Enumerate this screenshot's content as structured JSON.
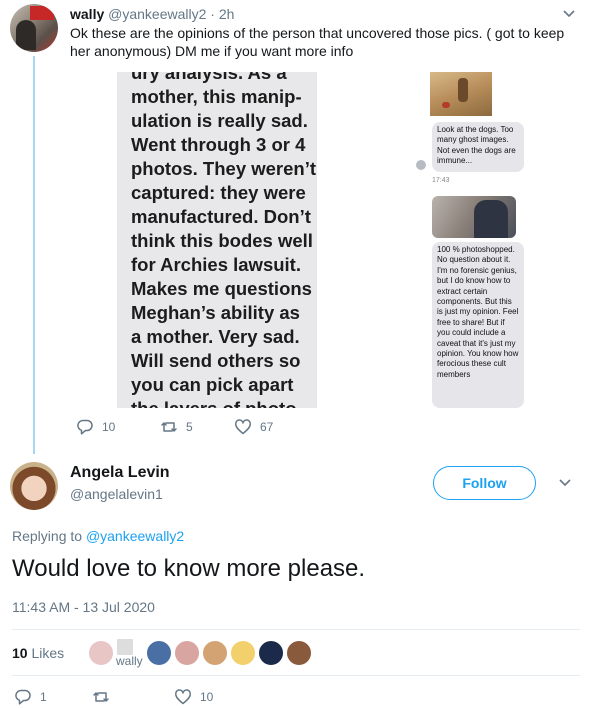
{
  "parent": {
    "name": "wally",
    "handle": "@yankeewally2",
    "separator": "·",
    "age": "2h",
    "text": "Ok these are the opinions of the person that uncovered those pics. ( got to keep her anonymous) DM me if you want more info",
    "media": {
      "left_lines": [
        "ury analysis. As a",
        "mother, this manip-",
        "ulation is really sad.",
        "Went through 3 or 4",
        "photos. They weren’t",
        "captured: they were",
        "manufactured. Don’t",
        "think this bodes well",
        "for Archies lawsuit.",
        "Makes me questions",
        "Meghan’s ability as",
        "a mother. Very sad.",
        "Will send others so",
        "you can pick apart",
        "the layers of photo"
      ],
      "bubble1": "Look at the dogs. Too many ghost images. Not even the dogs are immune...",
      "time": "17:43",
      "bubble2": "100 % photoshopped. No question about it. I'm no forensic genius, but I do know how to extract certain components. But this is just my opinion. Feel free to share! But if you could include a caveat that it's just my opinion. You know how ferocious these cult members"
    },
    "actions": {
      "replies": "10",
      "retweets": "5",
      "likes": "67"
    }
  },
  "reply": {
    "name": "Angela Levin",
    "handle": "@angelalevin1",
    "follow_label": "Follow",
    "replying_prefix": "Replying to",
    "replying_handle": "@yankeewally2",
    "text": "Would love to know more please.",
    "timestamp": "11:43 AM - 13 Jul 2020",
    "likes_count": "10",
    "likes_label": "Likes",
    "liker_text": "wally",
    "actions": {
      "replies": "1",
      "retweets": "",
      "likes": "10"
    }
  },
  "colors": {
    "accent": "#1da1f2",
    "muted": "#657786",
    "thread_line": "#a8d6f5"
  },
  "icons": [
    "chevron-down-icon",
    "reply-icon",
    "retweet-icon",
    "heart-icon"
  ]
}
